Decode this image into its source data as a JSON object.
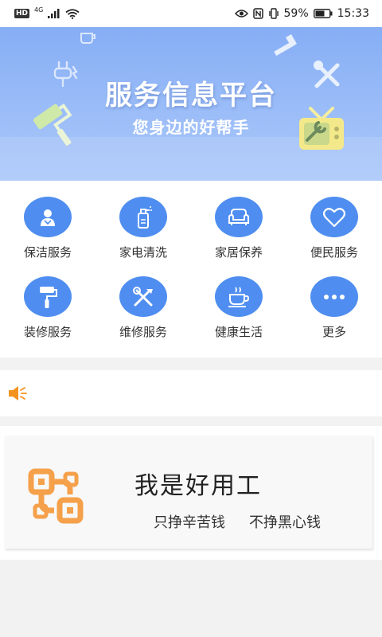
{
  "status_bar": {
    "hd": "HD",
    "network": "4G",
    "battery": "59%",
    "time": "15:33"
  },
  "banner": {
    "title": "服务信息平台",
    "subtitle": "您身边的好帮手"
  },
  "services": [
    {
      "label": "保洁服务",
      "icon": "cleaner-icon"
    },
    {
      "label": "家电清洗",
      "icon": "spray-bottle-icon"
    },
    {
      "label": "家居保养",
      "icon": "sofa-icon"
    },
    {
      "label": "便民服务",
      "icon": "heart-icon"
    },
    {
      "label": "装修服务",
      "icon": "paint-roller-icon"
    },
    {
      "label": "维修服务",
      "icon": "tools-icon"
    },
    {
      "label": "健康生活",
      "icon": "coffee-cup-icon"
    },
    {
      "label": "更多",
      "icon": "more-dots-icon"
    }
  ],
  "notice": {
    "icon": "speaker-icon",
    "text": ""
  },
  "promo": {
    "title": "我是好用工",
    "slogan_1": "只挣辛苦钱",
    "slogan_2": "不挣黑心钱"
  },
  "colors": {
    "accent": "#4f8ef0",
    "banner": "#95b8f7",
    "notice_icon": "#f5931f",
    "logo": "#f5a04a"
  }
}
